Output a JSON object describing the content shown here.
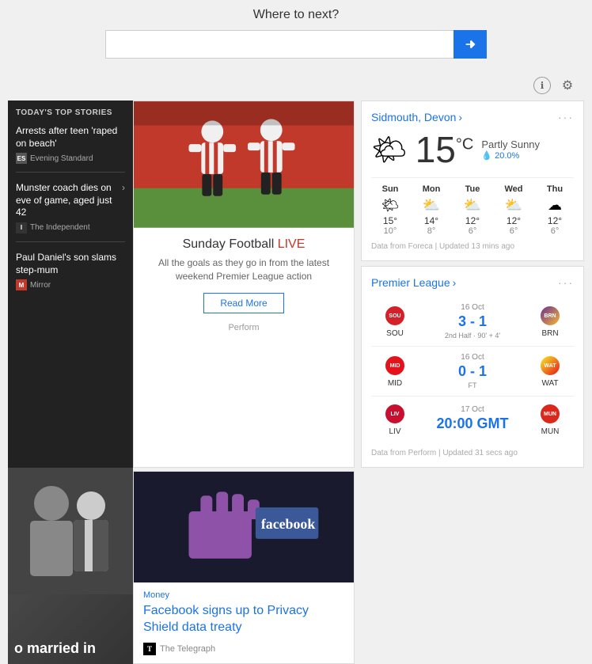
{
  "search": {
    "title": "Where to next?",
    "placeholder": "",
    "button_arrow": "→"
  },
  "top_stories": {
    "section_title": "TODAY'S TOP STORIES",
    "stories": [
      {
        "headline": "Arrests after teen 'raped on beach'",
        "source": "Evening Standard",
        "source_logo": "ES"
      },
      {
        "headline": "Munster coach dies on eve of game, aged just 42",
        "source": "The Independent",
        "source_logo": "I"
      },
      {
        "headline": "Paul Daniel's son slams step-mum",
        "source": "Mirror",
        "source_logo": "M"
      }
    ]
  },
  "football_article": {
    "title": "Sunday Football ",
    "title_live": "LIVE",
    "description": "All the goals as they go in from the latest weekend Premier League action",
    "read_more": "Read More",
    "provider": "Perform"
  },
  "facebook_article": {
    "category": "Money",
    "title": "Facebook signs up to Privacy Shield data treaty",
    "source": "The Telegraph",
    "source_logo": "T"
  },
  "celebrity": {
    "text": "o married in"
  },
  "weather": {
    "location": "Sidmouth, Devon",
    "temp": "15",
    "unit": "°C",
    "description": "Partly Sunny",
    "precip": "20.0%",
    "icon": "🌤",
    "forecast": [
      {
        "day": "Sun",
        "icon": "🌤",
        "hi": "15°",
        "lo": "10°"
      },
      {
        "day": "Mon",
        "icon": "⛅",
        "hi": "14°",
        "lo": "8°"
      },
      {
        "day": "Tue",
        "icon": "⛅",
        "hi": "12°",
        "lo": "6°"
      },
      {
        "day": "Wed",
        "icon": "⛅",
        "hi": "12°",
        "lo": "6°"
      },
      {
        "day": "Thu",
        "icon": "☁",
        "hi": "12°",
        "lo": "6°"
      }
    ],
    "footer": "Data from Foreca | Updated 13 mins ago"
  },
  "premier_league": {
    "title": "Premier League",
    "matches": [
      {
        "home": "SOU",
        "away": "BRN",
        "home_badge": "badge-sou",
        "away_badge": "badge-brn",
        "date": "16 Oct",
        "score": "3 - 1",
        "status": "2nd Half · 90' + 4'"
      },
      {
        "home": "MID",
        "away": "WAT",
        "home_badge": "badge-mid",
        "away_badge": "badge-wat",
        "date": "16 Oct",
        "score": "0 - 1",
        "status": "FT"
      },
      {
        "home": "LIV",
        "away": "MUN",
        "home_badge": "badge-liv",
        "away_badge": "badge-mun",
        "date": "17 Oct",
        "score": "20:00 GMT",
        "status": ""
      }
    ],
    "footer": "Data from Perform | Updated 31 secs ago"
  },
  "icons": {
    "info": "ℹ",
    "gear": "⚙",
    "chevron_right": "›",
    "ellipsis": "···"
  }
}
